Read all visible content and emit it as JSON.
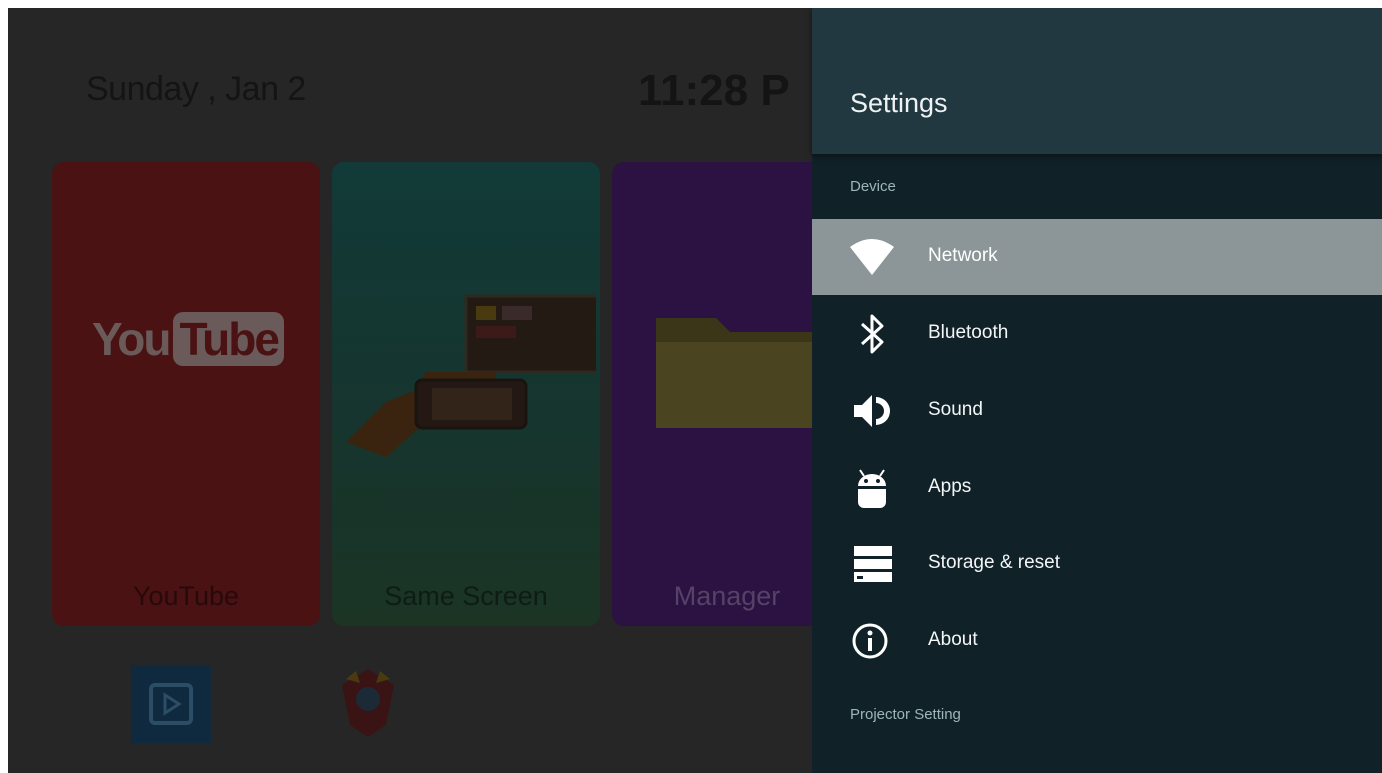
{
  "home": {
    "date": "Sunday , Jan 2",
    "time": "11:28  P",
    "tiles": [
      {
        "label": "YouTube",
        "logo_left": "You",
        "logo_right": "Tube"
      },
      {
        "label": "Same Screen"
      },
      {
        "label": "Manager"
      }
    ]
  },
  "settings": {
    "title": "Settings",
    "device_section": "Device",
    "items": [
      {
        "label": "Network",
        "icon": "wifi-icon",
        "selected": true
      },
      {
        "label": "Bluetooth",
        "icon": "bluetooth-icon"
      },
      {
        "label": "Sound",
        "icon": "speaker-icon"
      },
      {
        "label": "Apps",
        "icon": "android-icon"
      },
      {
        "label": "Storage & reset",
        "icon": "storage-icon"
      },
      {
        "label": "About",
        "icon": "info-icon"
      }
    ],
    "projector_section": "Projector Setting"
  },
  "colors": {
    "panel_bg": "#102128",
    "panel_header": "#213841",
    "selected_item": "#8c9698",
    "screen_dim": "#262626"
  }
}
